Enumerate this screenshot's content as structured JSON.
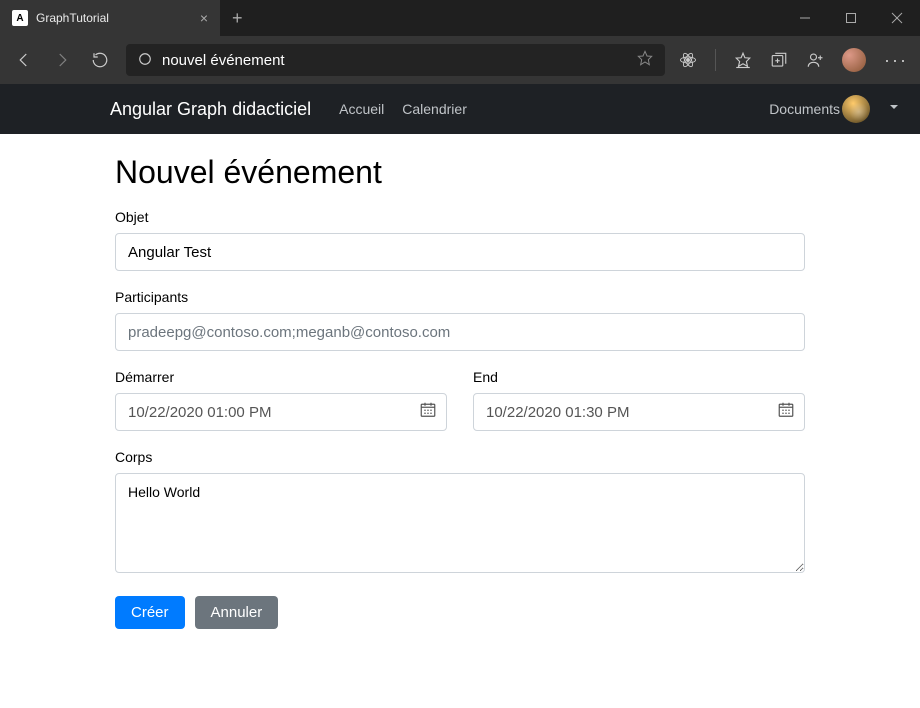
{
  "browser": {
    "tab_title": "GraphTutorial",
    "address_text": "nouvel événement"
  },
  "appnav": {
    "brand": "Angular Graph didacticiel",
    "links": [
      "Accueil",
      "Calendrier"
    ],
    "right_label": "Documents"
  },
  "form": {
    "title": "Nouvel événement",
    "subject_label": "Objet",
    "subject_value": "Angular Test",
    "attendees_label": "Participants",
    "attendees_placeholder": "pradeepg@contoso.com;meganb@contoso.com",
    "attendees_value": "",
    "start_label": "Démarrer",
    "start_value": "10/22/2020 01:00 PM",
    "end_label": "End",
    "end_value": "10/22/2020 01:30 PM",
    "body_label": "Corps",
    "body_value": "Hello World",
    "create_btn": "Créer",
    "cancel_btn": "Annuler"
  }
}
